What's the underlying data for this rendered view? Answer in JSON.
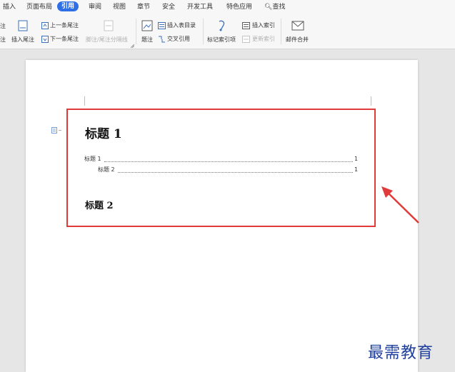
{
  "menu_tabs": [
    "插入",
    "页面布局",
    "引用",
    "审阅",
    "视图",
    "章节",
    "安全",
    "开发工具",
    "特色应用",
    "查找"
  ],
  "active_tab": "引用",
  "ribbon": {
    "partial_left_top": "注",
    "partial_left_bottom": "注",
    "insert_endnote": "插入尾注",
    "prev_endnote": "上一条尾注",
    "next_endnote": "下一条尾注",
    "footnote_separator": "脚注/尾注分隔线",
    "caption": "题注",
    "insert_table_of_figures": "插入表目录",
    "cross_reference": "交叉引用",
    "mark_index_entry": "标记索引项",
    "insert_index": "插入索引",
    "update_index": "更新索引",
    "mail_merge": "邮件合并"
  },
  "document": {
    "heading1": "标题 1",
    "toc": [
      {
        "text": "标题 1",
        "page": "1"
      },
      {
        "text": "标题 2",
        "page": "1"
      }
    ],
    "heading2": "标题 2"
  },
  "watermark": "最需教育",
  "colors": {
    "accent": "#2f6fe6",
    "highlight_border": "#e03a3a",
    "watermark": "#1f3f9c"
  }
}
